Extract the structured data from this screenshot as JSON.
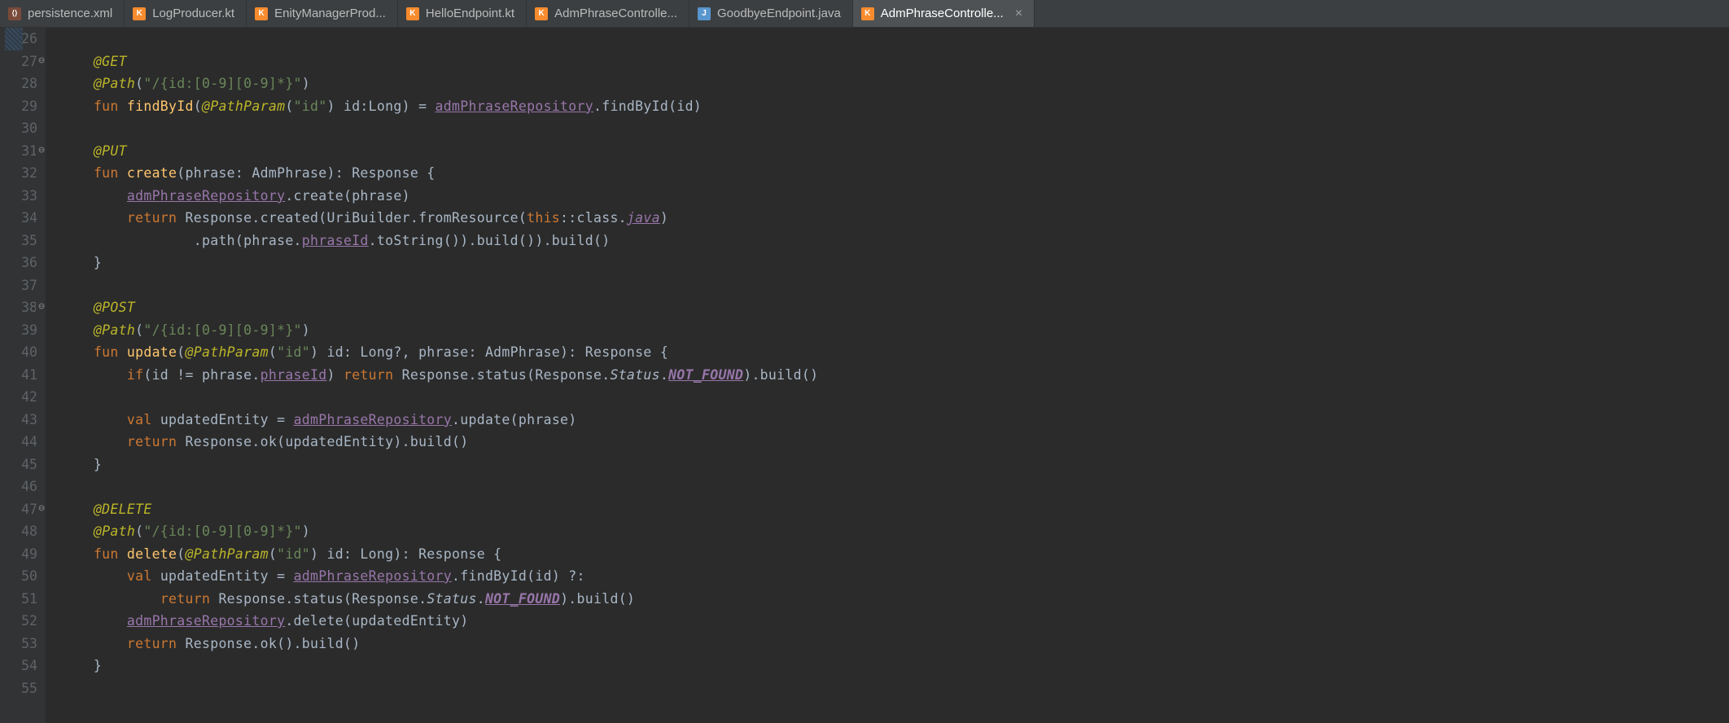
{
  "tabs": [
    {
      "label": "persistence.xml",
      "icon": "xml",
      "active": false
    },
    {
      "label": "LogProducer.kt",
      "icon": "kt",
      "active": false
    },
    {
      "label": "EnityManagerProd...",
      "icon": "kt",
      "active": false
    },
    {
      "label": "HelloEndpoint.kt",
      "icon": "kt",
      "active": false
    },
    {
      "label": "AdmPhraseControlle...",
      "icon": "kt",
      "active": false
    },
    {
      "label": "GoodbyeEndpoint.java",
      "icon": "java",
      "active": false
    },
    {
      "label": "AdmPhraseControlle...",
      "icon": "kt",
      "active": true,
      "closeable": true
    }
  ],
  "gutter": {
    "start": 26,
    "end": 55,
    "folds": [
      27,
      31,
      38,
      47
    ]
  },
  "code": {
    "l27": {
      "anno": "@GET"
    },
    "l28": {
      "anno": "@Path",
      "str": "\"/{id:[0-9][0-9]*}\""
    },
    "l29": {
      "kw1": "fun ",
      "fn": "findById",
      "pp": "@PathParam",
      "ppstr": "\"id\"",
      "pname": " id",
      "ptype": ":Long",
      "eq": ") = ",
      "repo": "admPhraseRepository",
      "call": ".findById(id)"
    },
    "l31": {
      "anno": "@PUT"
    },
    "l32": {
      "kw1": "fun ",
      "fn": "create",
      "pname": "phrase",
      "ptype": ": AdmPhrase",
      "ret": "): Response {"
    },
    "l33": {
      "repo": "admPhraseRepository",
      "call": ".create(phrase)"
    },
    "l34": {
      "kw": "return ",
      "resp": "Response.created(UriBuilder.fromResource(",
      "this": "this",
      "cls": "::class.",
      "java": "java",
      ")": ")"
    },
    "l35": {
      "pre": ".path(phrase.",
      "pid": "phraseId",
      ".ts": ".toString()).build()).build()"
    },
    "l36": {
      "br": "}"
    },
    "l38": {
      "anno": "@POST"
    },
    "l39": {
      "anno": "@Path",
      "str": "\"/{id:[0-9][0-9]*}\""
    },
    "l40": {
      "kw1": "fun ",
      "fn": "update",
      "pp": "@PathParam",
      "ppstr": "\"id\"",
      "pname": " id",
      "ptype": ": Long?",
      "p2": ", phrase: AdmPhrase): Response {"
    },
    "l41": {
      "kw": "if",
      "cond": "(id != phrase.",
      "pid": "phraseId",
      ") ": ") ",
      "ret": "return ",
      "resp": "Response.status(Response.",
      "status": "Status",
      ".": ".",
      "nf": "NOT_FOUND",
      "tail": ").build()"
    },
    "l43": {
      "kw": "val ",
      "name": "updatedEntity = ",
      "repo": "admPhraseRepository",
      "call": ".update(phrase)"
    },
    "l44": {
      "kw": "return ",
      "resp": "Response.ok(updatedEntity).build()"
    },
    "l45": {
      "br": "}"
    },
    "l47": {
      "anno": "@DELETE"
    },
    "l48": {
      "anno": "@Path",
      "str": "\"/{id:[0-9][0-9]*}\""
    },
    "l49": {
      "kw1": "fun ",
      "fn": "delete",
      "pp": "@PathParam",
      "ppstr": "\"id\"",
      "pname": " id",
      "ptype": ": Long",
      "ret": "): Response {"
    },
    "l50": {
      "kw": "val ",
      "name": "updatedEntity = ",
      "repo": "admPhraseRepository",
      "call": ".findById(id) ?:"
    },
    "l51": {
      "kw": "return ",
      "resp": "Response.status(Response.",
      "status": "Status",
      ".": ".",
      "nf": "NOT_FOUND",
      "tail": ").build()"
    },
    "l52": {
      "repo": "admPhraseRepository",
      "call": ".delete(updatedEntity)"
    },
    "l53": {
      "kw": "return ",
      "resp": "Response.ok().build()"
    },
    "l54": {
      "br": "}"
    }
  }
}
